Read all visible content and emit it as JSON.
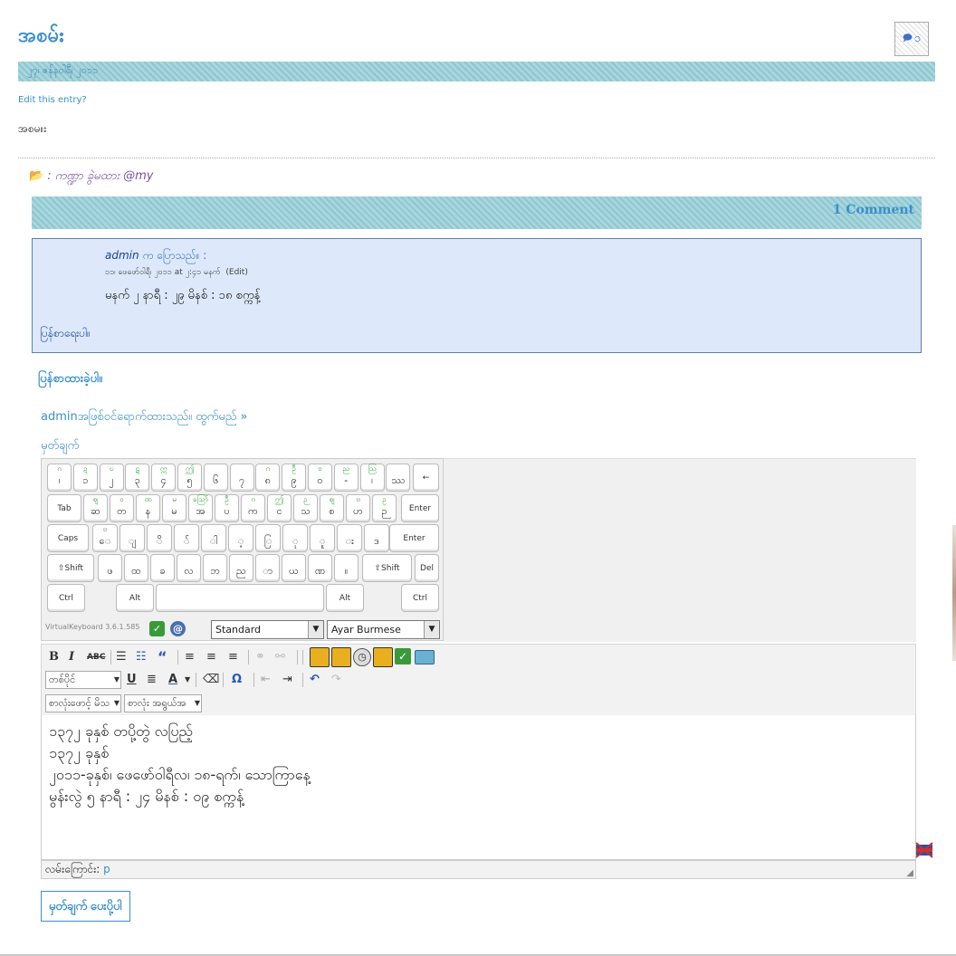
{
  "post": {
    "title": "အစမ်း",
    "comment_count": "၁",
    "date": "၂၇၊ ဇန်နဝါရီ၊ ၂၀၁၁",
    "edit_link": "Edit this entry?",
    "body": "အစမ။း",
    "category": ": ကဏ္ဍာ ခွဲမထား @my"
  },
  "comments": {
    "header": "1 Comment",
    "list": [
      {
        "author": "admin",
        "says": "က ပြောသည်။ :",
        "date": "၁၁၊ ဖေဖော်ဝါရီ၊ ၂၀၁၁ at ၂:၄၁ မနက်",
        "edit": "(Edit)",
        "text": "မနက် ၂ နာရီ : ၂၉ မိနစ် : ၁၈ စက္ကန့်",
        "reply": "ပြန်စာရေးပါ။"
      }
    ]
  },
  "reply_form": {
    "title": "ပြန်စာထားခဲ့ပါ။",
    "logged_in": "adminအဖြစ်ဝင်ရောက်ထားသည်။ ထွက်မည် »",
    "comment_label": "မှတ်ချက်",
    "submit": "မှတ်ချက် ပေးပို့ပါ"
  },
  "virtual_keyboard": {
    "version": "VirtualKeyboard 3.6.1.585",
    "layout_select": "Standard",
    "language_select": "Ayar Burmese",
    "row1": [
      {
        "s": "ဂ",
        "k": "၊"
      },
      {
        "s": "ဍ",
        "k": "၁"
      },
      {
        "s": "ဎ",
        "k": "၂"
      },
      {
        "s": "ဋ",
        "k": "၃"
      },
      {
        "s": "ဣ",
        "k": "၄"
      },
      {
        "s": "ဤ",
        "k": "၅"
      },
      {
        "s": "",
        "k": "၆"
      },
      {
        "s": "",
        "k": "၇"
      },
      {
        "s": "ဂ",
        "k": "၈"
      },
      {
        "s": "ဦ",
        "k": "၉"
      },
      {
        "s": "ဝ",
        "k": "၀"
      },
      {
        "s": "ည",
        "k": "-"
      },
      {
        "s": "ဩ",
        "k": "၊"
      },
      {
        "s": "",
        "k": "ဿ"
      }
    ],
    "row2": [
      {
        "s": "ဈ",
        "k": "ဆ"
      },
      {
        "s": "ဝ",
        "k": "တ"
      },
      {
        "s": "ဏ",
        "k": "န"
      },
      {
        "s": "မ",
        "k": "မ"
      },
      {
        "s": "ဪ",
        "k": "အ"
      },
      {
        "s": "ဦ",
        "k": "ပ"
      },
      {
        "s": "ဂ",
        "k": "က"
      },
      {
        "s": "ဤ",
        "k": "င"
      },
      {
        "s": "ဉ",
        "k": "သ"
      },
      {
        "s": "ဈ",
        "k": "စ"
      },
      {
        "s": "ဗ",
        "k": "ဟ"
      },
      {
        "s": "ဥ",
        "k": "ဉ"
      }
    ],
    "row3": [
      {
        "s": "ဗ",
        "k": "ေ"
      },
      {
        "s": "",
        "k": "ျ"
      },
      {
        "s": "",
        "k": "ိ"
      },
      {
        "s": "",
        "k": "်"
      },
      {
        "s": "",
        "k": "ါ"
      },
      {
        "s": "",
        "k": "့"
      },
      {
        "s": "",
        "k": "ြ"
      },
      {
        "s": "",
        "k": "ု"
      },
      {
        "s": "",
        "k": "ူ"
      },
      {
        "s": "",
        "k": "း"
      },
      {
        "s": "",
        "k": "ဒ"
      }
    ],
    "row4": [
      {
        "s": "",
        "k": "ဖ"
      },
      {
        "s": "",
        "k": "ထ"
      },
      {
        "s": "",
        "k": "ခ"
      },
      {
        "s": "",
        "k": "လ"
      },
      {
        "s": "",
        "k": "ဘ"
      },
      {
        "s": "",
        "k": "ည"
      },
      {
        "s": "",
        "k": "ာ"
      },
      {
        "s": "",
        "k": "ယ"
      },
      {
        "s": "",
        "k": "ဏ"
      },
      {
        "s": "",
        "k": "။"
      }
    ],
    "keys": {
      "backspace": "←",
      "tab": "Tab",
      "caps": "Caps Lock",
      "enter": "Enter",
      "shift": "⇧Shift",
      "del": "Del",
      "ctrl": "Ctrl",
      "alt": "Alt"
    }
  },
  "editor": {
    "font_select": "တစ်ပိုင်",
    "style_select_1": "စာလုံးဖောင့် မိသ",
    "style_select_2": "စာလုံး အရွယ်အ",
    "lines": [
      "၁၃၇၂ ခုနှစ် တပို့တွဲ လပြည့်",
      "၁၃၇၂ ခုနှစ်",
      "၂၀၁၁-ခုနှစ်၊ ဖေဖော်ဝါရီလ၊ ၁၈-ရက်၊ သောကြာနေ့",
      "မွန်းလွဲ ၅ နာရီ : ၂၄ မိနစ် : ၀၉ စက္ကန့်"
    ],
    "status_label": "လမ်းကြောင်း:",
    "status_path": "p"
  }
}
